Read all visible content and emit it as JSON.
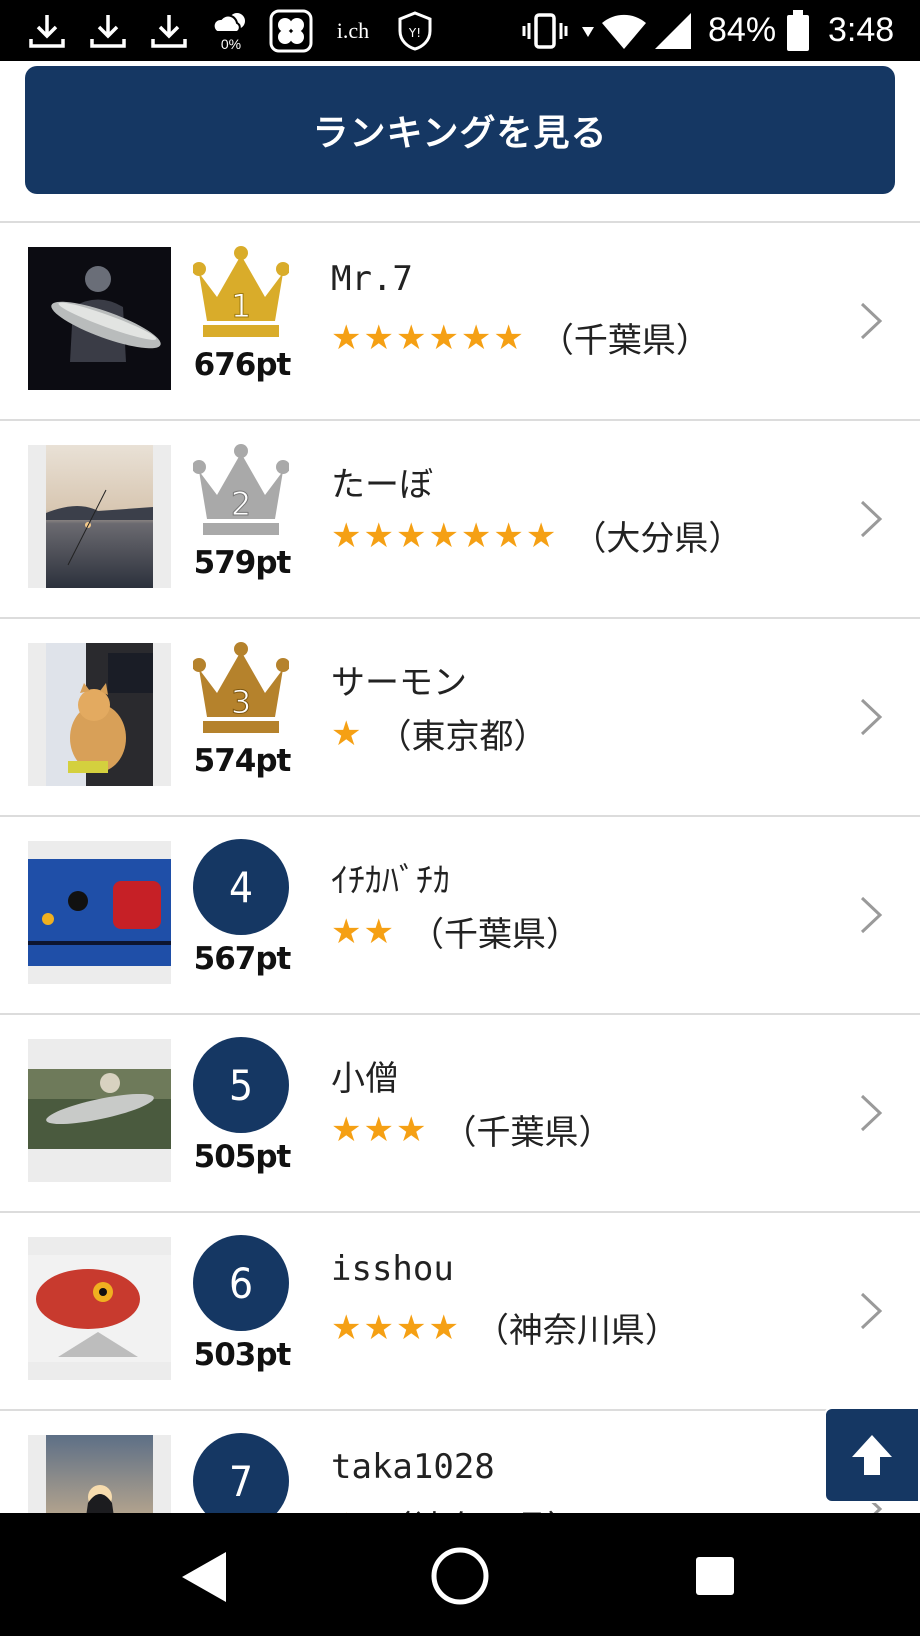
{
  "status_bar": {
    "battery": "84%",
    "time": "3:48",
    "weather_pct": "0%",
    "ich_label": "i.ch"
  },
  "ranking_button": {
    "label": "ランキングを見る"
  },
  "rows": [
    {
      "rank": "1",
      "points": "676pt",
      "name": "Mr.7",
      "stars": "★★★★★★",
      "prefecture": "（千葉県）",
      "badge": "gold-crown"
    },
    {
      "rank": "2",
      "points": "579pt",
      "name": "たーぼ",
      "stars": "★★★★★★★",
      "prefecture": "（大分県）",
      "badge": "silver-crown"
    },
    {
      "rank": "3",
      "points": "574pt",
      "name": "サーモン",
      "stars": "★",
      "prefecture": "（東京都）",
      "badge": "bronze-crown"
    },
    {
      "rank": "4",
      "points": "567pt",
      "name": "ｲﾁｶﾊﾞﾁｶ",
      "stars": "★★",
      "prefecture": "（千葉県）",
      "badge": "circle"
    },
    {
      "rank": "5",
      "points": "505pt",
      "name": "小僧",
      "stars": "★★★",
      "prefecture": "（千葉県）",
      "badge": "circle"
    },
    {
      "rank": "6",
      "points": "503pt",
      "name": "isshou",
      "stars": "★★★★",
      "prefecture": "（神奈川県）",
      "badge": "circle"
    },
    {
      "rank": "7",
      "points": "",
      "name": "taka1028",
      "stars": "★",
      "prefecture": "（神奈川県）",
      "badge": "circle"
    }
  ],
  "colors": {
    "navy": "#153763",
    "star": "#f5a014",
    "gold": "#d9ac2a",
    "silver": "#a9a9a9",
    "bronze": "#b5822c"
  }
}
